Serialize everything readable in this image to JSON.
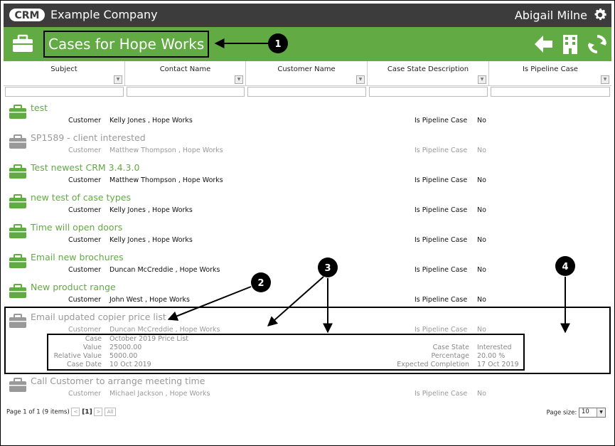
{
  "app": {
    "logo_text": "CRM",
    "company": "Example Company",
    "user": "Abigail Milne"
  },
  "header": {
    "title": "Cases for Hope Works"
  },
  "columns": [
    "Subject",
    "Contact Name",
    "Customer Name",
    "Case State Description",
    "Is Pipeline Case"
  ],
  "cases": [
    {
      "subject": "test",
      "customer_label": "Customer",
      "customer": "Kelly Jones , Hope Works",
      "pipeline_label": "Is Pipeline Case",
      "pipeline": "No",
      "status": "active"
    },
    {
      "subject": "SP1589 - client interested",
      "customer_label": "Customer",
      "customer": "Matthew Thompson , Hope Works",
      "pipeline_label": "Is Pipeline Case",
      "pipeline": "No",
      "status": "closed"
    },
    {
      "subject": "Test newest CRM 3.4.3.0",
      "customer_label": "Customer",
      "customer": "Matthew Thompson , Hope Works",
      "pipeline_label": "Is Pipeline Case",
      "pipeline": "No",
      "status": "active"
    },
    {
      "subject": "new test of case types",
      "customer_label": "Customer",
      "customer": "Kelly Jones , Hope Works",
      "pipeline_label": "Is Pipeline Case",
      "pipeline": "No",
      "status": "active"
    },
    {
      "subject": "Time will open doors",
      "customer_label": "Customer",
      "customer": "Kelly Jones , Hope Works",
      "pipeline_label": "Is Pipeline Case",
      "pipeline": "No",
      "status": "active"
    },
    {
      "subject": "Email new brochures",
      "customer_label": "Customer",
      "customer": "Duncan McCreddie , Hope Works",
      "pipeline_label": "Is Pipeline Case",
      "pipeline": "No",
      "status": "active"
    },
    {
      "subject": "New product range",
      "customer_label": "Customer",
      "customer": "John West , Hope Works",
      "pipeline_label": "Is Pipeline Case",
      "pipeline": "No",
      "status": "active"
    },
    {
      "subject": "Email updated copier price list",
      "customer_label": "Customer",
      "customer": "Duncan McCreddie , Hope Works",
      "pipeline_label": "Is Pipeline Case",
      "pipeline": "No",
      "status": "closed"
    },
    {
      "subject": "Call Customer to arrange meeting time",
      "customer_label": "Customer",
      "customer": "Michael Jackson , Hope Works",
      "pipeline_label": "Is Pipeline Case",
      "pipeline": "No",
      "status": "closed"
    }
  ],
  "expanded_case": {
    "left": [
      {
        "label": "Case",
        "value": "October 2019 Price List"
      },
      {
        "label": "Value",
        "value": "25000.00"
      },
      {
        "label": "Relative Value",
        "value": "5000.00"
      },
      {
        "label": "Case Date",
        "value": "10 Oct 2019"
      }
    ],
    "right": [
      {
        "label": "Case State",
        "value": "Interested"
      },
      {
        "label": "Percentage",
        "value": "20.00 %"
      },
      {
        "label": "Expected Completion",
        "value": "17 Oct 2019"
      }
    ]
  },
  "pager": {
    "summary": "Page 1 of 1 (9 items)",
    "prev": "<",
    "current": "[1]",
    "next": ">",
    "all": "All",
    "page_size_label": "Page size:",
    "page_size": "10"
  },
  "annotations": [
    "1",
    "2",
    "3",
    "4"
  ],
  "colors": {
    "topbar": "#3c3c3c",
    "accent_green": "#62aa43",
    "closed_grey": "#999999"
  },
  "icons": {
    "header_left": "briefcase-icon",
    "back": "arrow-left-icon",
    "company": "building-icon",
    "refresh": "refresh-icon",
    "settings": "gear-icon"
  }
}
